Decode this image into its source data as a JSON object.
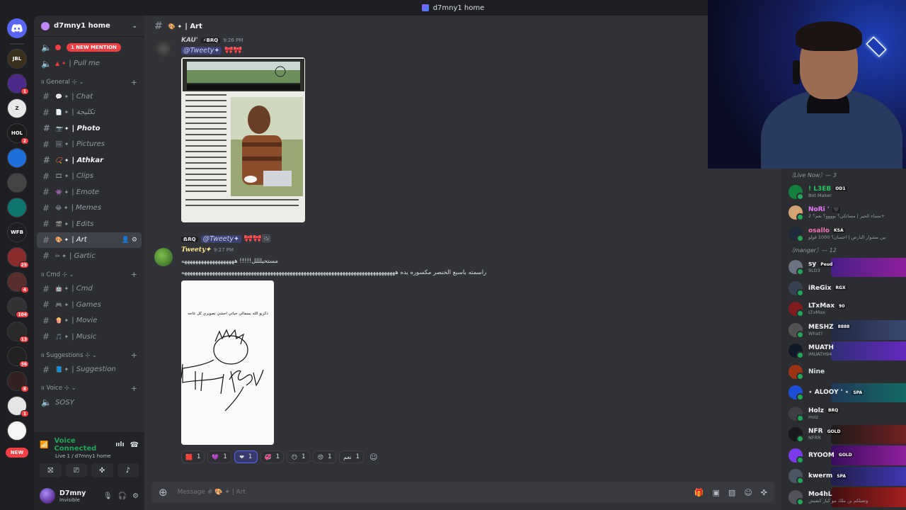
{
  "window": {
    "title": "d7mny1 home"
  },
  "rail": {
    "servers": [
      {
        "label": "JBL",
        "color": "#3a2f1c",
        "badge": ""
      },
      {
        "label": "",
        "color": "#4b2a8a",
        "badge": "1"
      },
      {
        "label": "Z",
        "color": "#e8e8e8",
        "badge": ""
      },
      {
        "label": "HOL",
        "color": "#1b1b1b",
        "badge": "2"
      },
      {
        "label": "",
        "color": "#1e6fd9",
        "badge": ""
      },
      {
        "label": "",
        "color": "#444",
        "badge": ""
      },
      {
        "label": "",
        "color": "#0f766e",
        "badge": ""
      },
      {
        "label": "WFB",
        "color": "#1e1f22",
        "badge": ""
      },
      {
        "label": "",
        "color": "#8b2c2c",
        "badge": "25"
      },
      {
        "label": "",
        "color": "#5b2e2e",
        "badge": "4"
      },
      {
        "label": "",
        "color": "#333",
        "badge": "104"
      },
      {
        "label": "",
        "color": "#2a2a2a",
        "badge": "13"
      },
      {
        "label": "",
        "color": "#222",
        "badge": "36"
      },
      {
        "label": "",
        "color": "#332222",
        "badge": "8"
      },
      {
        "label": "",
        "color": "#e5e5e5",
        "badge": "1"
      },
      {
        "label": "",
        "color": "#f5f5f5",
        "badge": ""
      }
    ],
    "new_label": "NEW"
  },
  "sidebar": {
    "guild_name": "d7mny1 home",
    "top_channels": [
      {
        "icon": "speaker",
        "emoji": "",
        "name": "",
        "mention": "1 NEW MENTION"
      },
      {
        "icon": "speaker",
        "emoji": "▲ ✦",
        "name": "| Pull me",
        "mention": ""
      }
    ],
    "categories": [
      {
        "name": "ıı General ⊹ ⌄",
        "channels": [
          {
            "emoji": "💬 ✦",
            "name": "| Chat",
            "state": "normal"
          },
          {
            "emoji": "📄 ✦",
            "name": "| تكليجة",
            "state": "normal"
          },
          {
            "emoji": "📷 ✦",
            "name": "| Photo",
            "state": "unread"
          },
          {
            "emoji": "🖼 ✦",
            "name": "| Pictures",
            "state": "normal"
          },
          {
            "emoji": "📿 ✦",
            "name": "| Athkar",
            "state": "unread"
          },
          {
            "emoji": "🎞 ✦",
            "name": "| Clips",
            "state": "normal"
          },
          {
            "emoji": "👾 ✦",
            "name": "| Emote",
            "state": "normal"
          },
          {
            "emoji": "😂 ✦",
            "name": "| Memes",
            "state": "normal"
          },
          {
            "emoji": "🎬 ✦",
            "name": "| Edits",
            "state": "normal"
          },
          {
            "emoji": "🎨 ✦",
            "name": "| Art",
            "state": "active"
          },
          {
            "emoji": "✏ ✦",
            "name": "| Gartic",
            "state": "normal"
          }
        ]
      },
      {
        "name": "ıı Cmd ⊹ ⌄",
        "channels": [
          {
            "emoji": "🤖 ✦",
            "name": "| Cmd",
            "state": "normal"
          },
          {
            "emoji": "🎮 ✦",
            "name": "| Games",
            "state": "normal"
          },
          {
            "emoji": "🍿 ✦",
            "name": "| Movie",
            "state": "normal"
          },
          {
            "emoji": "🎵 ✦",
            "name": "| Music",
            "state": "normal"
          }
        ]
      },
      {
        "name": "ıı Suggestions ⊹ ⌄",
        "channels": [
          {
            "emoji": "📘 ✦",
            "name": "| Suggestion",
            "state": "normal"
          }
        ]
      },
      {
        "name": "ıı Voice ⊹ ⌄",
        "channels": [
          {
            "emoji": "",
            "name": "SOSY",
            "state": "voice"
          }
        ]
      }
    ],
    "voice": {
      "status": "Voice Connected",
      "channel": "Live 1 / d7mny1 home"
    },
    "user": {
      "name": "D7mny",
      "status": "Invisible"
    }
  },
  "channel_header": {
    "name": "| Art",
    "emoji": "🎨 ✦"
  },
  "messages": [
    {
      "author": "KAU'",
      "tag": "⚡BRQ",
      "time": "9:26 PM",
      "mention": "@Tweety✦",
      "image_caption": "or Skype. Perhaps watching a video from internet makes it easy to photos and videos with make it possible for anyone to learn online."
    },
    {
      "reply_author": "ẞRQ",
      "reply_mention": "@Tweety✦",
      "author": "Tweety✦",
      "time": "9:27 PM",
      "line1": "مستحيلللل!!!!! هههههههههههههههههههه",
      "line2": "راسمته باسبع الخنصر مكسوره يده هههههههههههههههههههههههههههههههههههههههههههههههههههههههههههههههههههههههههههههه",
      "drawing_text": "ذكريو الله يسمالي حياتي احشي تصويري كل عاحه"
    }
  ],
  "reactions": [
    {
      "emoji": "🟥",
      "count": "1",
      "me": false
    },
    {
      "emoji": "💜",
      "count": "1",
      "me": false
    },
    {
      "emoji": "❤",
      "count": "1",
      "me": true
    },
    {
      "emoji": "💞",
      "count": "1",
      "me": false
    },
    {
      "emoji": "😶",
      "count": "1",
      "me": false
    },
    {
      "emoji": "😔",
      "count": "1",
      "me": false
    },
    {
      "emoji": "نعم",
      "count": "1",
      "me": false
    }
  ],
  "composer": {
    "placeholder": "Message # 🎨 ✦ | Art"
  },
  "members": {
    "groups": [
      {
        "title": "〘Live Now〙— 3",
        "items": [
          {
            "name": "! L3EB",
            "tag": "OD1",
            "status": "Bot Maker",
            "color": "#22c55e",
            "av": "#15803d",
            "bg": ""
          },
          {
            "name": "NoRi '",
            "tag": "🖤",
            "status": "مساء الخير | مسائكي؟ يوووو؟ نعم؟ 2+",
            "color": "#e879f9",
            "av": "#d4a373",
            "bg": ""
          },
          {
            "name": "osallo",
            "tag": "KSA",
            "status": "بين مشوار البارض | احسان؟ 1000 قولو",
            "color": "#f472b6",
            "av": "#1f2937",
            "bg": ""
          }
        ]
      },
      {
        "title": "〘manger〙— 12",
        "items": [
          {
            "name": "sy",
            "tag": "Peud",
            "status": "9LO3",
            "color": "#f2f3f5",
            "av": "#6b7280",
            "bg": "linear-gradient(90deg,#4c1d95,#a21caf)"
          },
          {
            "name": "iReGix",
            "tag": "RGX",
            "status": "",
            "color": "#f2f3f5",
            "av": "#374151",
            "bg": ""
          },
          {
            "name": "LTxMax",
            "tag": "90",
            "status": "LTxMax",
            "color": "#f2f3f5",
            "av": "#7f1d1d",
            "bg": ""
          },
          {
            "name": "MESHZ",
            "tag": "8888",
            "status": "What?",
            "color": "#f2f3f5",
            "av": "#525252",
            "bg": "linear-gradient(90deg,#1f2a48,#3b4c7a)"
          },
          {
            "name": "MUATH",
            "tag": "",
            "status": "iMUATH94",
            "color": "#f2f3f5",
            "av": "#111827",
            "bg": "linear-gradient(90deg,#312e81,#6d28d9)"
          },
          {
            "name": "Nine",
            "tag": "",
            "status": "",
            "color": "#dbdee1",
            "av": "#9a3412",
            "bg": ""
          },
          {
            "name": "⋆ ALOOY ' ⋆",
            "tag": "SPA",
            "status": "",
            "color": "#f2f3f5",
            "av": "#1d4ed8",
            "bg": "linear-gradient(90deg,#1e3a5f,#0f766e)"
          },
          {
            "name": "Holz",
            "tag": "BRQ",
            "status": "Holz",
            "color": "#f2f3f5",
            "av": "#3f3f46",
            "bg": ""
          },
          {
            "name": "NFR",
            "tag": "GOLD",
            "status": "NFRR",
            "color": "#f2f3f5",
            "av": "#18181b",
            "bg": "linear-gradient(90deg,#1c1917,#7f1d1d)"
          },
          {
            "name": "RYOOM",
            "tag": "GOLD",
            "status": "",
            "color": "#f2f3f5",
            "av": "#7c3aed",
            "bg": "linear-gradient(90deg,#3b0764,#a21caf)"
          },
          {
            "name": "kwerm",
            "tag": "SPA",
            "status": "",
            "color": "#f2f3f5",
            "av": "#4b5563",
            "bg": "linear-gradient(90deg,#1e1b4b,#4338ca)"
          },
          {
            "name": "Mo4hL",
            "tag": "",
            "status": "وتصلكم بن ملك مو كبار كنقيش",
            "color": "#f2f3f5",
            "av": "#52525b",
            "bg": "linear-gradient(90deg,#450a0a,#b91c1c)"
          }
        ]
      }
    ]
  }
}
